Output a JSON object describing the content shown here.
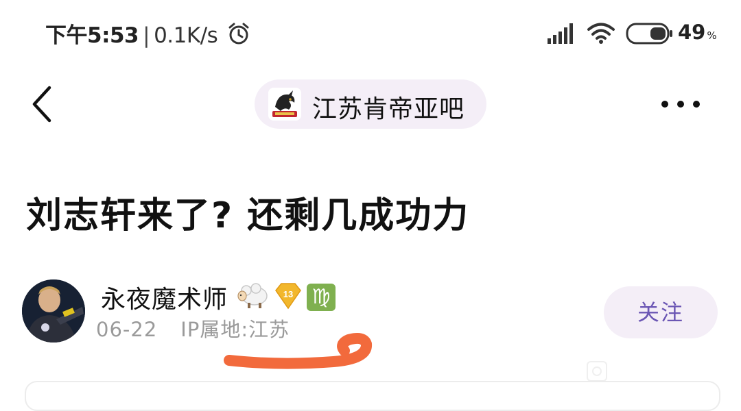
{
  "status_bar": {
    "time": "下午5:53",
    "separator": "|",
    "network_speed": "0.1K/s",
    "battery_percent": "49",
    "battery_unit": "%",
    "icons": [
      "alarm-icon",
      "signal-icon",
      "wifi-icon",
      "battery-icon"
    ]
  },
  "nav": {
    "forum_name": "江苏肯帝亚吧",
    "icons": [
      "back-icon",
      "forum-logo",
      "more-icon"
    ]
  },
  "post": {
    "title": "刘志轩来了? 还剩几成功力"
  },
  "author": {
    "name": "永夜魔术师",
    "level": "13",
    "zodiac_glyph": "♍",
    "date": "06-22",
    "ip_location": "IP属地:江苏",
    "follow_label": "关注",
    "icons": [
      "sheep-icon",
      "level-badge-icon",
      "zodiac-badge"
    ]
  },
  "annotation": {
    "color": "#f26a3c"
  },
  "colors": {
    "pill_bg": "#f4eef7",
    "follow_text": "#6b56b4",
    "meta_text": "#9a9a9a"
  }
}
